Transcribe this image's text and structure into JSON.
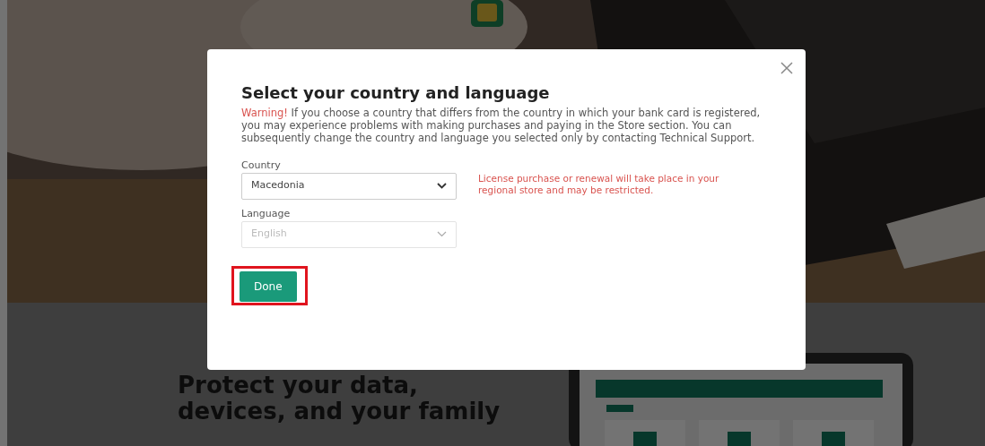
{
  "page": {
    "headline_lines": [
      "Protect your data,",
      "devices, and your family"
    ]
  },
  "modal": {
    "title": "Select your country and language",
    "warning_label": "Warning!",
    "warning_text": "If you choose a country that differs from the country in which your bank card is registered, you may experience problems with making purchases and paying in the Store section. You can subsequently change the country and language you selected only by contacting Technical Support.",
    "fields": [
      {
        "label": "Country",
        "value": "Macedonia",
        "disabled": false
      },
      {
        "label": "Language",
        "value": "English",
        "disabled": true
      }
    ],
    "region_note": "License purchase or renewal will take place in your regional store and may be restricted.",
    "done_button": {
      "label": "Done",
      "highlighted": true
    }
  }
}
